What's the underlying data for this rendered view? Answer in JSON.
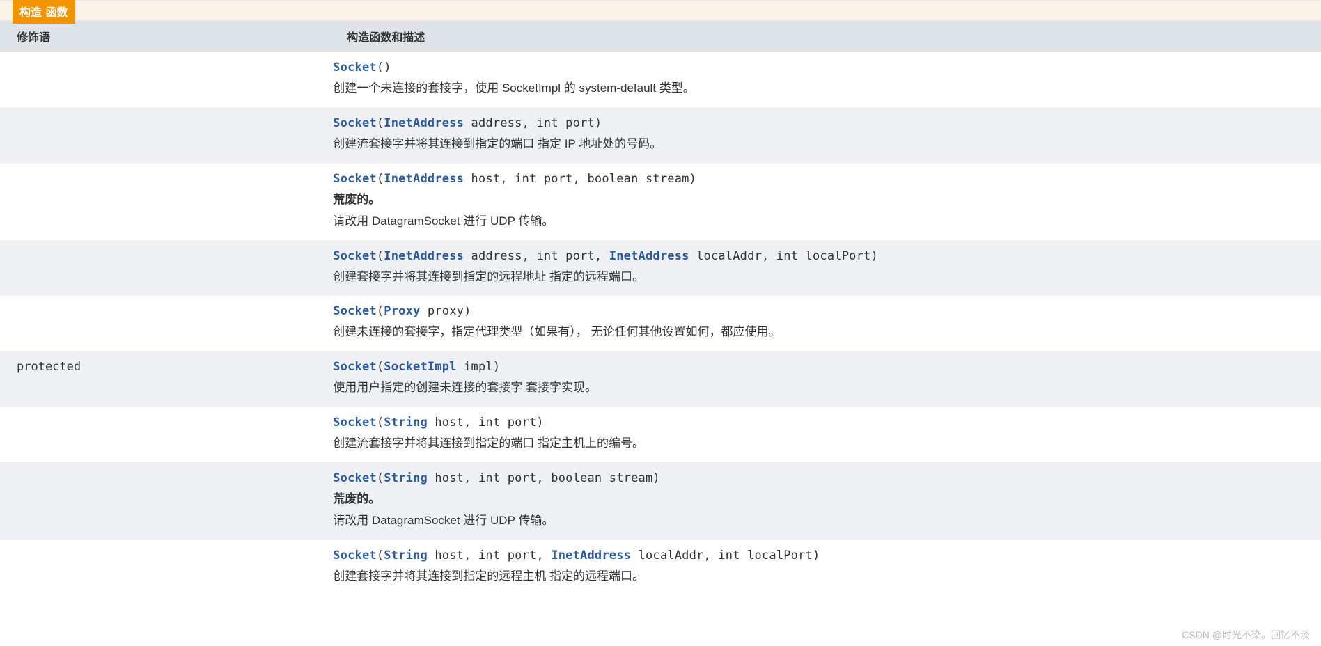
{
  "section_title": "构造 函数",
  "columns": {
    "modifier": "修饰语",
    "description": "构造函数和描述"
  },
  "class_name": "Socket",
  "rows": [
    {
      "modifier": "",
      "signature_parts": [
        {
          "kind": "name",
          "text": "Socket"
        },
        {
          "kind": "plain",
          "text": "()"
        }
      ],
      "deprecated": "",
      "description": "创建一个未连接的套接字，使用 SocketImpl 的 system-default 类型。"
    },
    {
      "modifier": "",
      "signature_parts": [
        {
          "kind": "name",
          "text": "Socket"
        },
        {
          "kind": "plain",
          "text": "("
        },
        {
          "kind": "type",
          "text": "InetAddress"
        },
        {
          "kind": "plain",
          "text": " address, int port)"
        }
      ],
      "deprecated": "",
      "description": "创建流套接字并将其连接到指定的端口 指定 IP 地址处的号码。"
    },
    {
      "modifier": "",
      "signature_parts": [
        {
          "kind": "name",
          "text": "Socket"
        },
        {
          "kind": "plain",
          "text": "("
        },
        {
          "kind": "type",
          "text": "InetAddress"
        },
        {
          "kind": "plain",
          "text": " host, int port, boolean stream)"
        }
      ],
      "deprecated": "荒废的。",
      "description": "请改用 DatagramSocket 进行 UDP 传输。"
    },
    {
      "modifier": "",
      "signature_parts": [
        {
          "kind": "name",
          "text": "Socket"
        },
        {
          "kind": "plain",
          "text": "("
        },
        {
          "kind": "type",
          "text": "InetAddress"
        },
        {
          "kind": "plain",
          "text": " address, int port, "
        },
        {
          "kind": "type",
          "text": "InetAddress"
        },
        {
          "kind": "plain",
          "text": " localAddr, int localPort)"
        }
      ],
      "deprecated": "",
      "description": "创建套接字并将其连接到指定的远程地址 指定的远程端口。"
    },
    {
      "modifier": "",
      "signature_parts": [
        {
          "kind": "name",
          "text": "Socket"
        },
        {
          "kind": "plain",
          "text": "("
        },
        {
          "kind": "type",
          "text": "Proxy"
        },
        {
          "kind": "plain",
          "text": " proxy)"
        }
      ],
      "deprecated": "",
      "description": "创建未连接的套接字，指定代理类型（如果有）， 无论任何其他设置如何，都应使用。"
    },
    {
      "modifier": "protected ",
      "signature_parts": [
        {
          "kind": "name",
          "text": "Socket"
        },
        {
          "kind": "plain",
          "text": "("
        },
        {
          "kind": "type",
          "text": "SocketImpl"
        },
        {
          "kind": "plain",
          "text": " impl)"
        }
      ],
      "deprecated": "",
      "description": "使用用户指定的创建未连接的套接字 套接字实现。"
    },
    {
      "modifier": "",
      "signature_parts": [
        {
          "kind": "name",
          "text": "Socket"
        },
        {
          "kind": "plain",
          "text": "("
        },
        {
          "kind": "type",
          "text": "String"
        },
        {
          "kind": "plain",
          "text": " host, int port)"
        }
      ],
      "deprecated": "",
      "description": "创建流套接字并将其连接到指定的端口 指定主机上的编号。"
    },
    {
      "modifier": "",
      "signature_parts": [
        {
          "kind": "name",
          "text": "Socket"
        },
        {
          "kind": "plain",
          "text": "("
        },
        {
          "kind": "type",
          "text": "String"
        },
        {
          "kind": "plain",
          "text": " host, int port, boolean stream)"
        }
      ],
      "deprecated": "荒废的。",
      "description": "请改用 DatagramSocket 进行 UDP 传输。"
    },
    {
      "modifier": "",
      "signature_parts": [
        {
          "kind": "name",
          "text": "Socket"
        },
        {
          "kind": "plain",
          "text": "("
        },
        {
          "kind": "type",
          "text": "String"
        },
        {
          "kind": "plain",
          "text": " host, int port, "
        },
        {
          "kind": "type",
          "text": "InetAddress"
        },
        {
          "kind": "plain",
          "text": " localAddr, int localPort)"
        }
      ],
      "deprecated": "",
      "description": "创建套接字并将其连接到指定的远程主机 指定的远程端口。"
    }
  ],
  "watermark": "CSDN @时光不染。回忆不淡"
}
